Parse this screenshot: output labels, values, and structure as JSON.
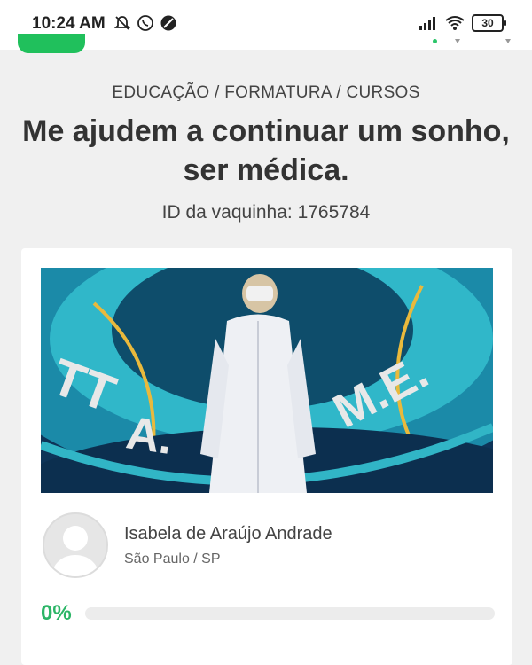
{
  "status_bar": {
    "time": "10:24 AM",
    "battery": "30",
    "icons": [
      "mute-bell-icon",
      "whatsapp-icon",
      "no-disturb-icon",
      "signal-icon",
      "wifi-icon",
      "battery-icon"
    ]
  },
  "campaign": {
    "category": "EDUCAÇÃO / FORMATURA / CURSOS",
    "title": "Me ajudem a continuar um sonho, ser médica.",
    "id_label": "ID da vaquinha: 1765784",
    "owner_name": "Isabela de Araújo Andrade",
    "owner_location": "São Paulo / SP",
    "progress_label": "0%",
    "progress_value": 0
  },
  "colors": {
    "accent": "#2bb566",
    "brand": "#20c05c",
    "background": "#f0f0f0"
  }
}
